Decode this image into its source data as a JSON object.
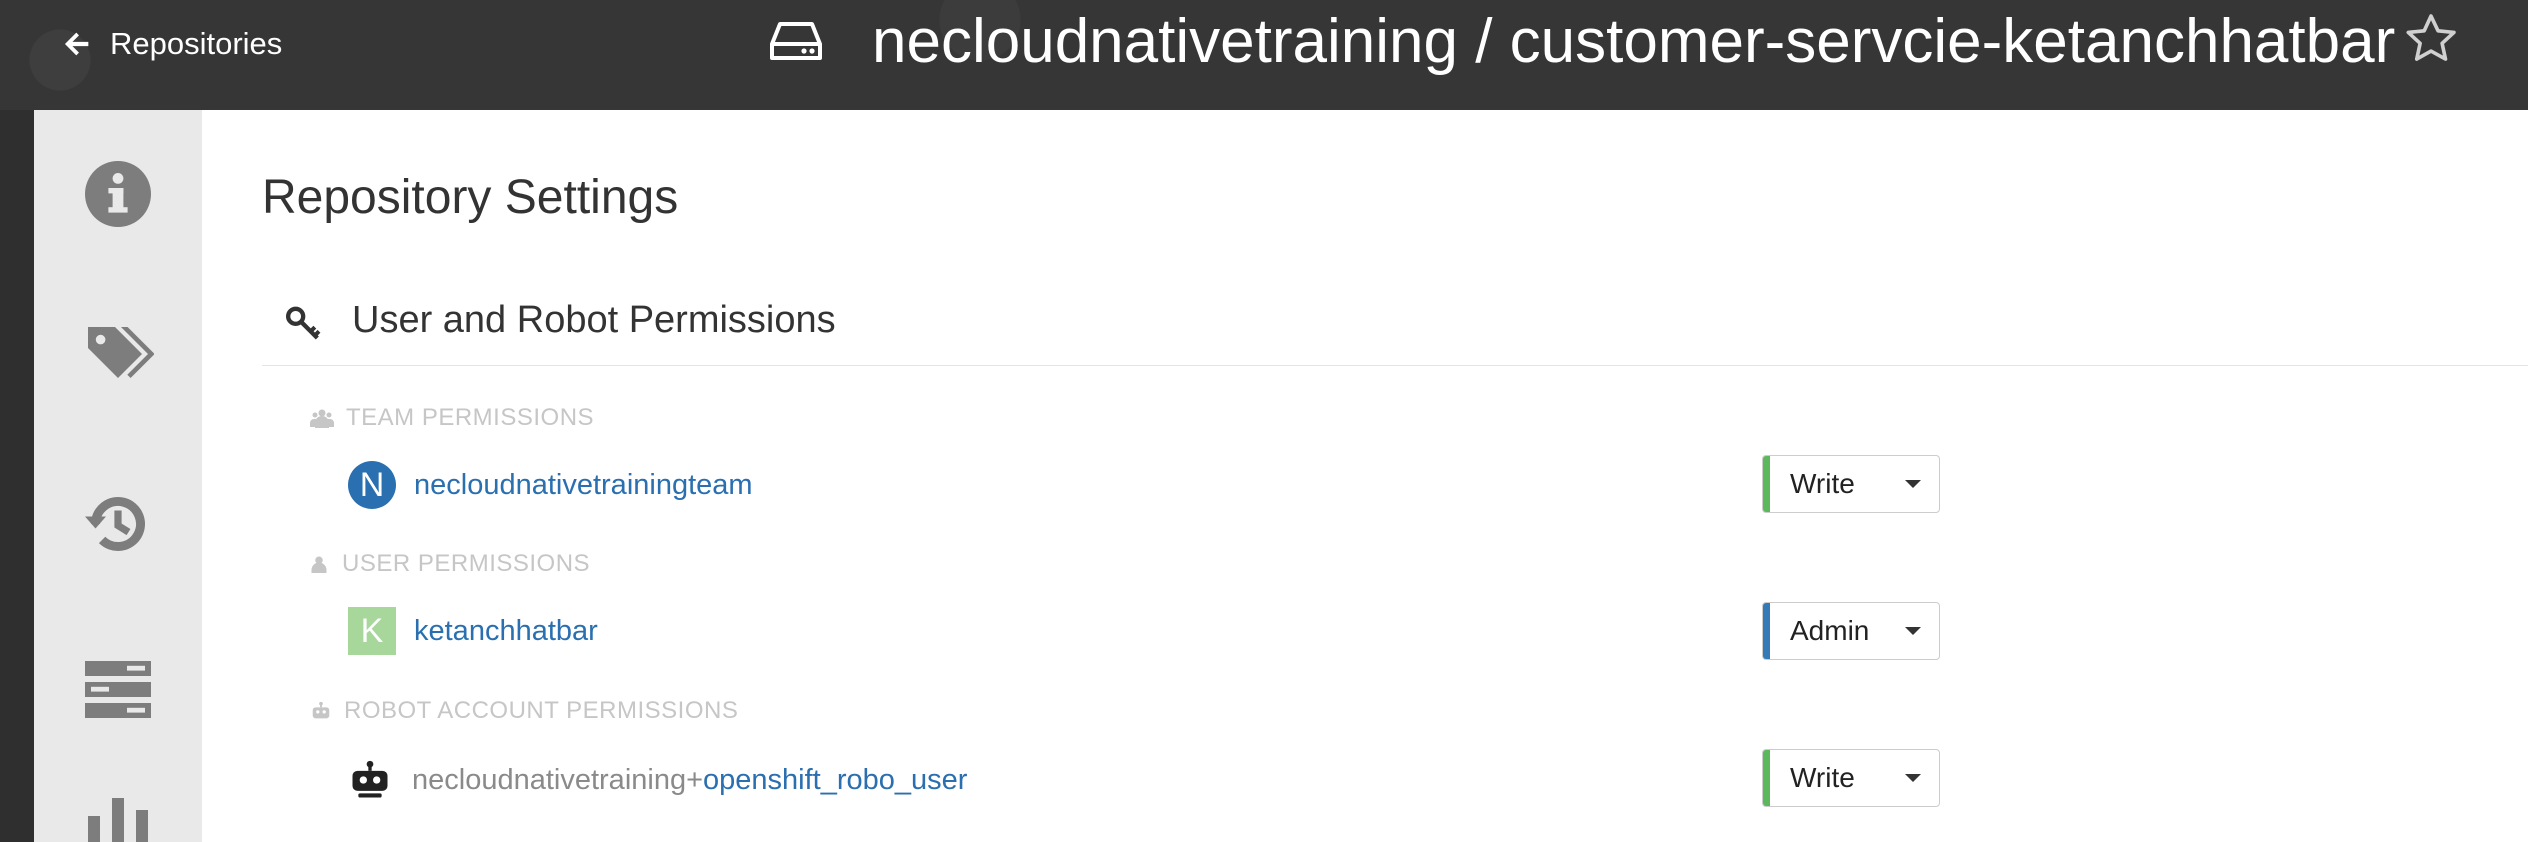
{
  "header": {
    "back_label": "Repositories",
    "repo_title": "necloudnativetraining / customer-servcie-ketanchhatbar",
    "repo_icon": "hard-drive-icon",
    "star_icon": "star-icon"
  },
  "sidebar": {
    "items": [
      {
        "icon": "info-icon"
      },
      {
        "icon": "tags-icon"
      },
      {
        "icon": "history-icon"
      },
      {
        "icon": "builds-icon"
      },
      {
        "icon": "chart-icon"
      }
    ]
  },
  "page": {
    "title": "Repository Settings",
    "section_title": "User and Robot Permissions",
    "section_icon": "key-icon"
  },
  "permissions": {
    "team": {
      "label": "TEAM PERMISSIONS",
      "entries": [
        {
          "avatar_letter": "N",
          "name": "necloudnativetrainingteam",
          "role": "Write",
          "role_color": "#5cb85c"
        }
      ]
    },
    "user": {
      "label": "USER PERMISSIONS",
      "entries": [
        {
          "avatar_letter": "K",
          "name": "ketanchhatbar",
          "role": "Admin",
          "role_color": "#337ab7"
        }
      ]
    },
    "robot": {
      "label": "ROBOT ACCOUNT PERMISSIONS",
      "entries": [
        {
          "prefix": "necloudnativetraining+",
          "name": "openshift_robo_user",
          "role": "Write",
          "role_color": "#5cb85c"
        }
      ]
    }
  },
  "colors": {
    "header_bg": "#363636",
    "link": "#2a6fb0",
    "write": "#5cb85c",
    "admin": "#337ab7",
    "team_avatar": "#2a70b0",
    "user_avatar": "#a7d79a"
  }
}
